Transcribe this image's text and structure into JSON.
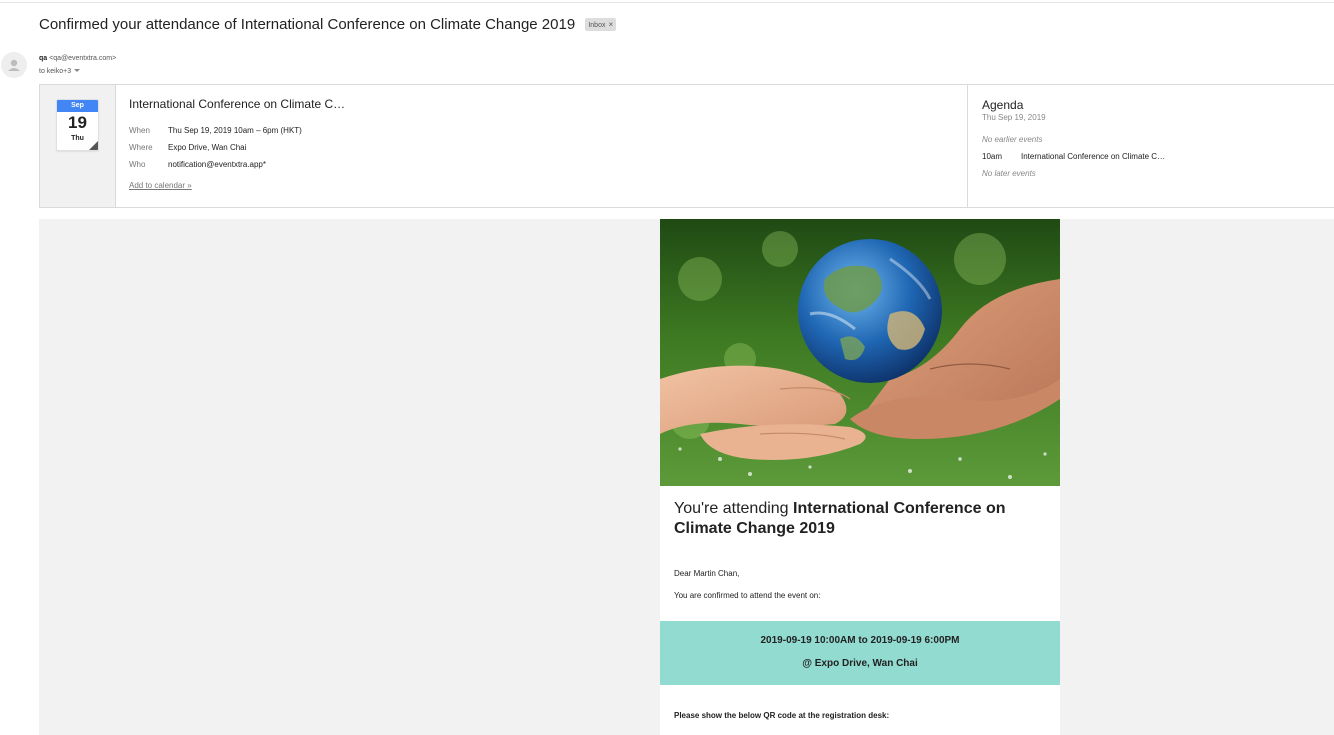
{
  "email": {
    "subject": "Confirmed your attendance of International Conference on Climate Change 2019",
    "label": "Inbox",
    "sender_name": "qa",
    "sender_email": "<qa@eventxtra.com>",
    "recipients": "to keiko+3"
  },
  "invite": {
    "month": "Sep",
    "day": "19",
    "weekday": "Thu",
    "title": "International Conference on Climate C…",
    "when_label": "When",
    "when_value": "Thu Sep 19, 2019 10am – 6pm (HKT)",
    "where_label": "Where",
    "where_value": "Expo Drive, Wan Chai",
    "who_label": "Who",
    "who_value": "notification@eventxtra.app*",
    "add_calendar": "Add to calendar »"
  },
  "agenda": {
    "title": "Agenda",
    "date": "Thu Sep 19, 2019",
    "no_earlier": "No earlier events",
    "event_time": "10am",
    "event_title": "International Conference on Climate C…",
    "no_later": "No later events"
  },
  "message": {
    "headline_prefix": "You're attending ",
    "headline_event": "International Conference on Climate Change 2019",
    "greeting": "Dear Martin Chan,",
    "confirm_text": "You are confirmed to attend the event on:",
    "datetime": "2019-09-19 10:00AM to 2019-09-19 6:00PM",
    "location": "@ Expo Drive, Wan Chai",
    "qr_instruction": "Please show the below QR code at the registration desk:"
  },
  "colors": {
    "calendar_month": "#4285f4",
    "info_box": "#92dbd1",
    "body_background": "#f2f2f2"
  },
  "hero_image": "hands-holding-earth-globe"
}
